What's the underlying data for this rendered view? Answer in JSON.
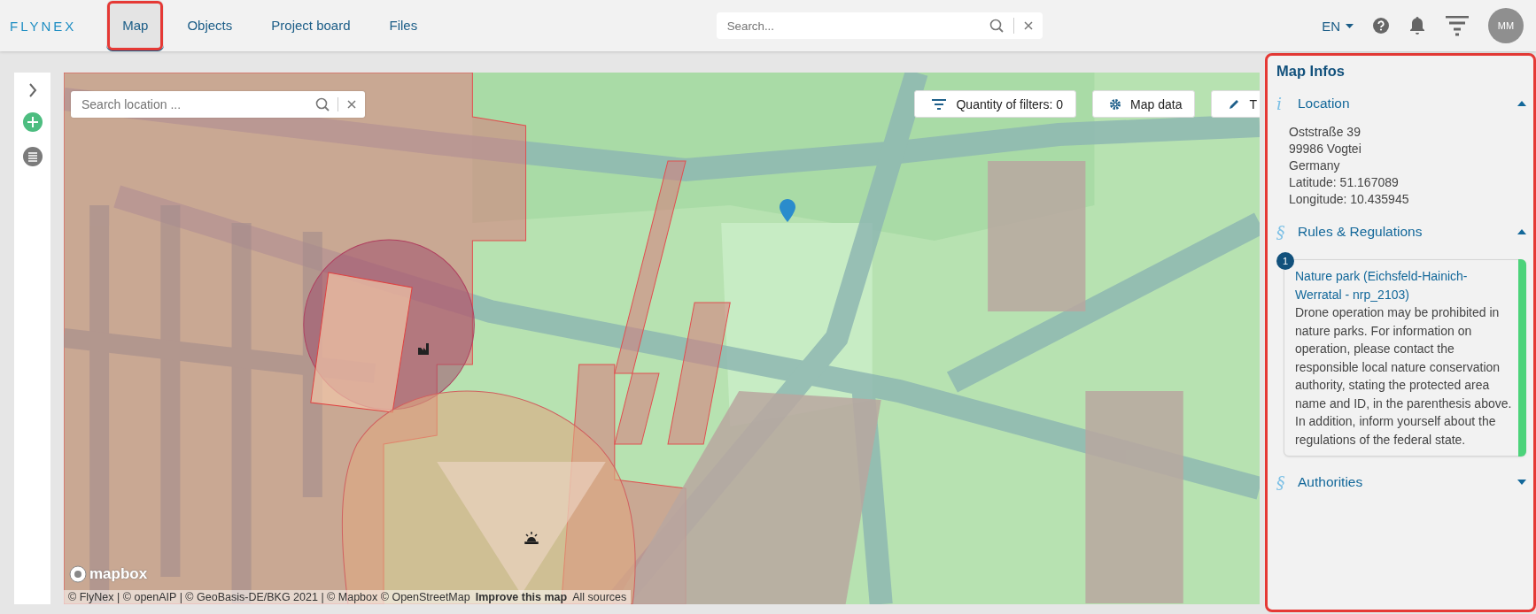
{
  "logo": "FLYNEX",
  "nav": [
    {
      "label": "Map",
      "selected": true,
      "highlighted": true
    },
    {
      "label": "Objects",
      "selected": false,
      "highlighted": false
    },
    {
      "label": "Project board",
      "selected": false,
      "highlighted": false
    },
    {
      "label": "Files",
      "selected": false,
      "highlighted": false
    }
  ],
  "search": {
    "placeholder": "Search..."
  },
  "language": "EN",
  "avatar": "MM",
  "map": {
    "search_placeholder": "Search location ...",
    "buttons": [
      {
        "label": "Quantity of filters: 0",
        "kind": "filter"
      },
      {
        "label": "Map data",
        "kind": "gear"
      },
      {
        "label": "T",
        "kind": "pencil"
      }
    ],
    "logo": "mapbox",
    "attribution": "© FlyNex | © openAIP | © GeoBasis-DE/BKG 2021 | © Mapbox © OpenStreetMap",
    "improve_link": "Improve this map",
    "sources_link": "All sources"
  },
  "panel": {
    "title": "Map Infos",
    "highlighted": true,
    "sections": [
      {
        "symbol": "i",
        "title": "Location",
        "kind": "lines",
        "expanded": true,
        "lines": [
          "Oststraße 39",
          "99986 Vogtei",
          "Germany",
          "Latitude: 51.167089",
          "Longitude: 10.435945"
        ]
      },
      {
        "symbol": "§",
        "title": "Rules & Regulations",
        "kind": "rules",
        "expanded": true,
        "rules": [
          {
            "number": "1",
            "title": "Nature park (Eichsfeld-Hainich-Werratal - nrp_2103)",
            "text": "Drone operation may be prohibited in nature parks. For information on operation, please contact the responsible local nature conservation authority, stating the protected area name and ID, in the parenthesis above. In addition, inform yourself about the regulations of the federal state.",
            "color": "#4cd37a"
          }
        ]
      },
      {
        "symbol": "§",
        "title": "Authorities",
        "kind": "rules",
        "expanded": false
      }
    ]
  }
}
